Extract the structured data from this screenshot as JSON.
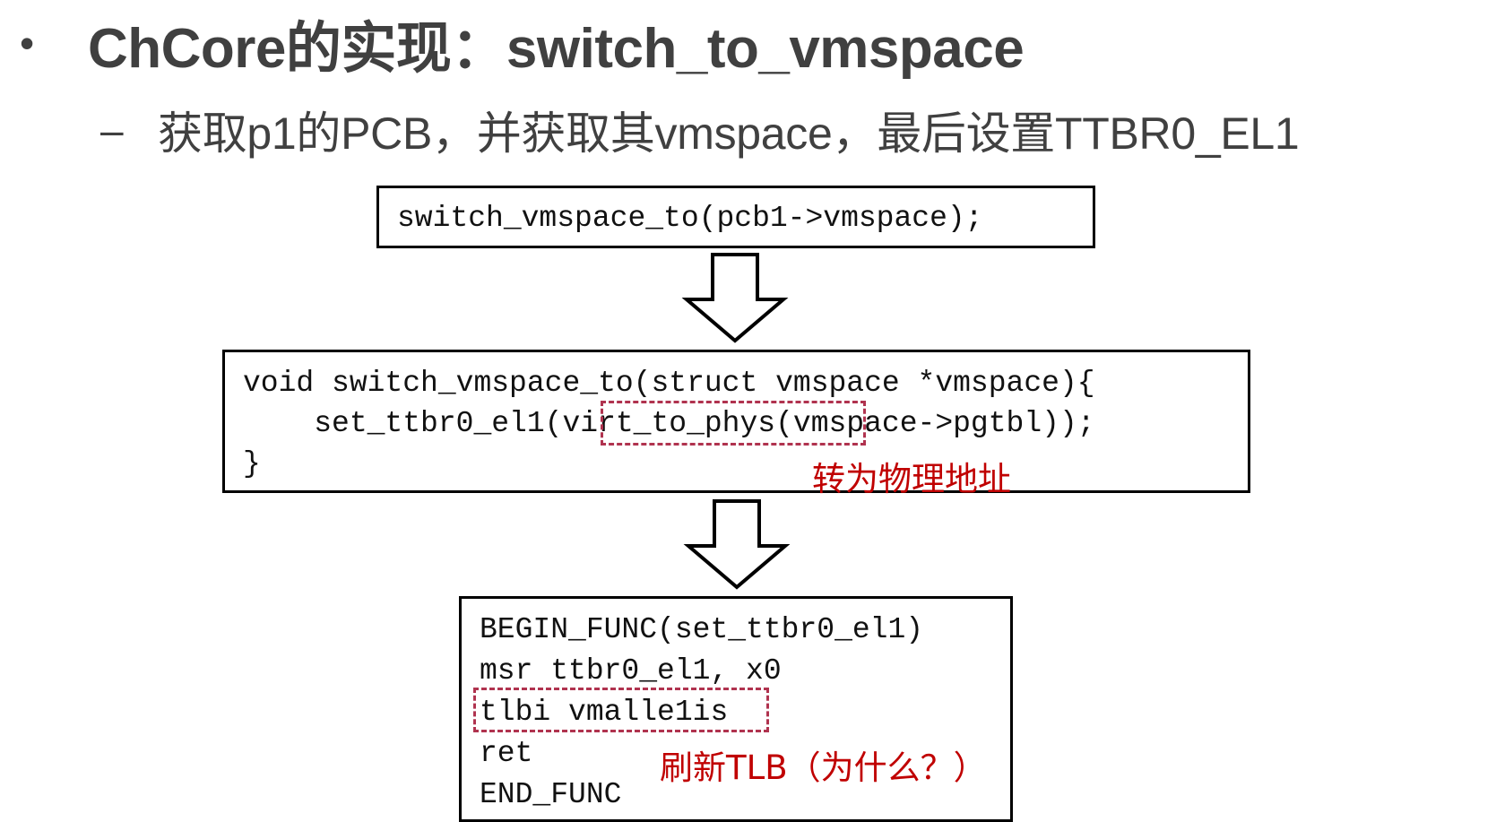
{
  "slide": {
    "bullet": "•",
    "title": "ChCore的实现：switch_to_vmspace",
    "sub_bullet": "–",
    "subtitle": "获取p1的PCB，并获取其vmspace，最后设置TTBR0_EL1"
  },
  "box1": {
    "line1": "switch_vmspace_to(pcb1->vmspace);"
  },
  "box2": {
    "line1": "void switch_vmspace_to(struct vmspace *vmspace){",
    "line2": "    set_ttbr0_el1(virt_to_phys(vmspace->pgtbl));",
    "line3": "}",
    "note": "转为物理地址"
  },
  "box3": {
    "line1": "BEGIN_FUNC(set_ttbr0_el1)",
    "line2": "msr ttbr0_el1, x0",
    "line3": "tlbi vmalle1is",
    "line4": "ret",
    "line5": "END_FUNC",
    "note": "刷新TLB（为什么？）"
  },
  "colors": {
    "text": "#404040",
    "highlight_border": "#b0334f",
    "note": "#c00000"
  }
}
